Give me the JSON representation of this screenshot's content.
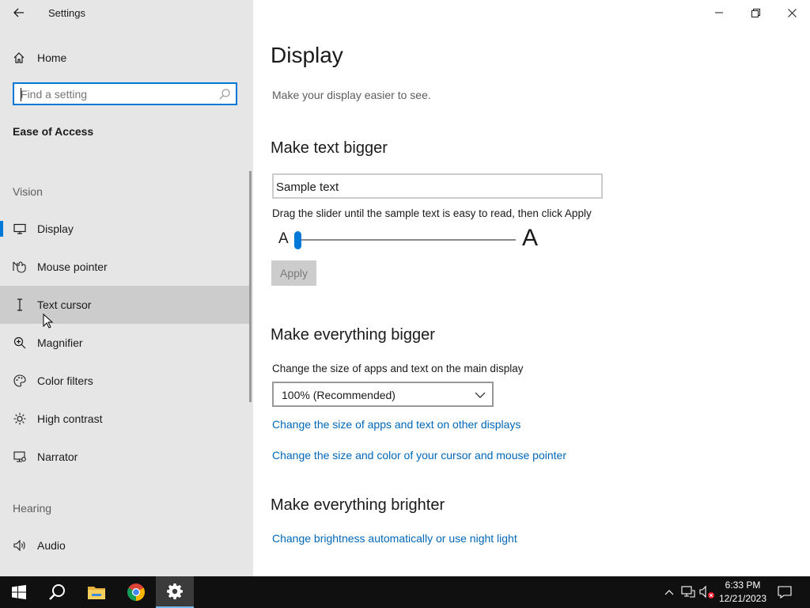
{
  "window": {
    "title": "Settings"
  },
  "sidebar": {
    "home_label": "Home",
    "search": {
      "placeholder": "Find a setting",
      "value": ""
    },
    "section_title": "Ease of Access",
    "groups": {
      "vision_label": "Vision",
      "hearing_label": "Hearing"
    },
    "items": [
      {
        "label": "Display",
        "icon": "monitor-icon",
        "selected": true
      },
      {
        "label": "Mouse pointer",
        "icon": "mouse-pointer-icon"
      },
      {
        "label": "Text cursor",
        "icon": "text-cursor-icon",
        "hover": true
      },
      {
        "label": "Magnifier",
        "icon": "magnifier-icon"
      },
      {
        "label": "Color filters",
        "icon": "color-filters-icon"
      },
      {
        "label": "High contrast",
        "icon": "high-contrast-icon"
      },
      {
        "label": "Narrator",
        "icon": "narrator-icon"
      },
      {
        "label": "Audio",
        "icon": "audio-icon"
      }
    ]
  },
  "main": {
    "title": "Display",
    "description": "Make your display easier to see.",
    "text_bigger": {
      "heading": "Make text bigger",
      "sample_text": "Sample text",
      "hint": "Drag the slider until the sample text is easy to read, then click Apply",
      "slider_min_label": "A",
      "slider_max_label": "A",
      "slider_value_percent": 0,
      "apply_label": "Apply"
    },
    "everything_bigger": {
      "heading": "Make everything bigger",
      "scale_label": "Change the size of apps and text on the main display",
      "scale_value": "100% (Recommended)",
      "link_other_displays": "Change the size of apps and text on other displays",
      "link_cursor": "Change the size and color of your cursor and mouse pointer"
    },
    "everything_brighter": {
      "heading": "Make everything brighter",
      "link_brightness": "Change brightness automatically or use night light"
    }
  },
  "taskbar": {
    "time": "6:33 PM",
    "date": "12/21/2023",
    "accent_color": "#76b9ed"
  },
  "colors": {
    "accent": "#0078d7",
    "link": "#0067b8",
    "sidebar_bg": "#e6e6e6"
  }
}
